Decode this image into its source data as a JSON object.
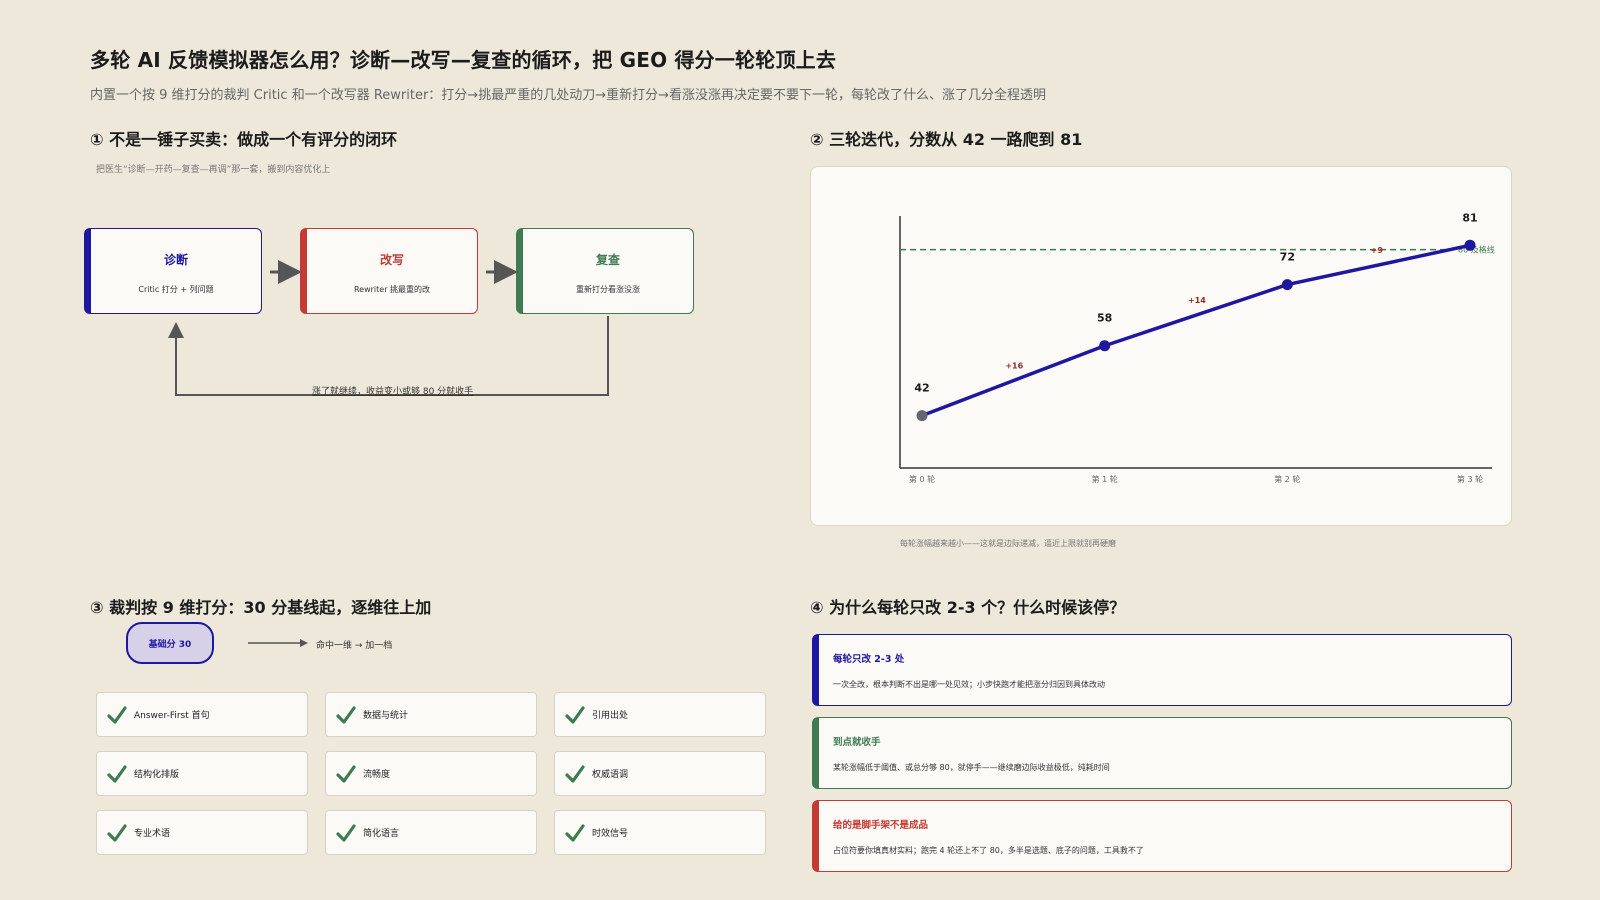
{
  "header": {
    "title": "多轮 AI 反馈模拟器怎么用？诊断—改写—复查的循环，把 GEO 得分一轮轮顶上去",
    "subtitle": "内置一个按 9 维打分的裁判 Critic 和一个改写器 Rewriter：打分→挑最严重的几处动刀→重新打分→看涨没涨再决定要不要下一轮，每轮改了什么、涨了几分全程透明"
  },
  "section1": {
    "title": "① 不是一锤子买卖：做成一个有评分的闭环",
    "note": "把医生“诊断—开药—复查—再调”那一套，搬到内容优化上",
    "boxes": [
      {
        "title": "诊断",
        "desc": "Critic 打分 + 列问题",
        "color": "#1e17a0"
      },
      {
        "title": "改写",
        "desc": "Rewriter 挑最重的改",
        "color": "#c43a34"
      },
      {
        "title": "复查",
        "desc": "重新打分看涨没涨",
        "color": "#3e7b52"
      }
    ],
    "loop_label": "涨了就继续，收益变小或够 80 分就收手"
  },
  "section2": {
    "title": "② 三轮迭代，分数从 42 一路爬到 81",
    "caption": "每轮涨幅越来越小——这就是边际递减，逼近上限就别再硬磨"
  },
  "chart_data": {
    "type": "line",
    "categories": [
      "第 0 轮",
      "第 1 轮",
      "第 2 轮",
      "第 3 轮"
    ],
    "values": [
      42,
      58,
      72,
      81
    ],
    "increments": [
      "+16",
      "+14",
      "+9"
    ],
    "threshold": {
      "value": 80,
      "label": "80 及格线",
      "color": "#3e7b52"
    },
    "ylim": [
      30,
      90
    ],
    "line_color": "#1e17a0",
    "first_point_color": "#66666e",
    "increment_color": "#9b2a25",
    "grid": false
  },
  "section3": {
    "title": "③ 裁判按 9 维打分：30 分基线起，逐维往上加",
    "base_label": "基础分 30",
    "rule_text": "命中一维 → 加一档",
    "check_color": "#3e7b52",
    "dimensions": [
      "Answer-First 首句",
      "数据与统计",
      "引用出处",
      "结构化排版",
      "流畅度",
      "权威语调",
      "专业术语",
      "简化语言",
      "时效信号"
    ]
  },
  "section4": {
    "title": "④ 为什么每轮只改 2-3 个？什么时候该停？",
    "tips": [
      {
        "title": "每轮只改 2-3 处",
        "desc": "一次全改，根本判断不出是哪一处见效；小步快跑才能把涨分归因到具体改动",
        "color": "#1e17a0"
      },
      {
        "title": "到点就收手",
        "desc": "某轮涨幅低于阈值、或总分够 80，就停手——继续磨边际收益极低，纯耗时间",
        "color": "#3e7b52"
      },
      {
        "title": "给的是脚手架不是成品",
        "desc": "占位符要你填真材实料；跑完 4 轮还上不了 80，多半是选题、底子的问题，工具救不了",
        "color": "#c43a34"
      }
    ]
  }
}
